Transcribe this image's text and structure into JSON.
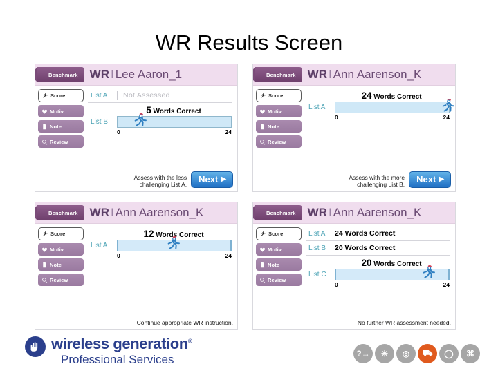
{
  "slide": {
    "title": "WR Results Screen"
  },
  "panels": [
    {
      "id": "panel-lee-aaron",
      "tab_label": "Benchmark",
      "title_prefix": "WR",
      "title_sep": "I",
      "student": "Lee Aaron_1",
      "sidebar": [
        {
          "label": "Score",
          "icon": "runner-icon",
          "active": true
        },
        {
          "label": "Motiv.",
          "icon": "heart-icon",
          "active": false
        },
        {
          "label": "Note",
          "icon": "note-icon",
          "active": false
        },
        {
          "label": "Review",
          "icon": "magnifier-icon",
          "active": false
        }
      ],
      "rows": [
        {
          "list": "List A",
          "status": "Not Assessed",
          "type": "not-assessed"
        }
      ],
      "bar": {
        "list": "List B",
        "score": 5,
        "caption_value": "5",
        "caption_text": "Words Correct",
        "min": "0",
        "max": "24",
        "max_value": 24,
        "style": "filled"
      },
      "footer_note": "Assess with the less\nchallenging List A.",
      "next_label": "Next",
      "next_arrow": "▶",
      "has_next": true
    },
    {
      "id": "panel-ann-aarenson-24",
      "tab_label": "Benchmark",
      "title_prefix": "WR",
      "title_sep": "I",
      "student": "Ann Aarenson_K",
      "sidebar": [
        {
          "label": "Score",
          "icon": "runner-icon",
          "active": true
        },
        {
          "label": "Motiv.",
          "icon": "heart-icon",
          "active": false
        },
        {
          "label": "Note",
          "icon": "note-icon",
          "active": false
        },
        {
          "label": "Review",
          "icon": "magnifier-icon",
          "active": false
        }
      ],
      "rows": [],
      "bar": {
        "list": "List A",
        "score": 24,
        "caption_value": "24",
        "caption_text": "Words Correct",
        "min": "0",
        "max": "24",
        "max_value": 24,
        "style": "filled"
      },
      "footer_note": "Assess with the more\nchallenging List B.",
      "next_label": "Next",
      "next_arrow": "▶",
      "has_next": true
    },
    {
      "id": "panel-ann-aarenson-12",
      "tab_label": "Benchmark",
      "title_prefix": "WR",
      "title_sep": "I",
      "student": "Ann Aarenson_K",
      "sidebar": [
        {
          "label": "Score",
          "icon": "runner-icon",
          "active": true
        },
        {
          "label": "Motiv.",
          "icon": "heart-icon",
          "active": false
        },
        {
          "label": "Note",
          "icon": "note-icon",
          "active": false
        },
        {
          "label": "Review",
          "icon": "magnifier-icon",
          "active": false
        }
      ],
      "rows": [],
      "bar": {
        "list": "List A",
        "score": 12,
        "caption_value": "12",
        "caption_text": "Words Correct",
        "min": "0",
        "max": "24",
        "max_value": 24,
        "style": "open"
      },
      "footer_note": "Continue appropriate WR instruction.",
      "next_label": "",
      "next_arrow": "",
      "has_next": false
    },
    {
      "id": "panel-ann-aarenson-final",
      "tab_label": "Benchmark",
      "title_prefix": "WR",
      "title_sep": "I",
      "student": "Ann Aarenson_K",
      "sidebar": [
        {
          "label": "Score",
          "icon": "runner-icon",
          "active": true
        },
        {
          "label": "Motiv.",
          "icon": "heart-icon",
          "active": false
        },
        {
          "label": "Note",
          "icon": "note-icon",
          "active": false
        },
        {
          "label": "Review",
          "icon": "magnifier-icon",
          "active": false
        }
      ],
      "rows": [
        {
          "list": "List A",
          "status": "24 Words Correct",
          "type": "score"
        },
        {
          "list": "List B",
          "status": "20 Words Correct",
          "type": "score"
        }
      ],
      "bar": {
        "list": "List C",
        "score": 20,
        "caption_value": "20",
        "caption_text": "Words Correct",
        "min": "0",
        "max": "24",
        "max_value": 24,
        "style": "open"
      },
      "footer_note": "No further WR assessment needed.",
      "next_label": "",
      "next_arrow": "",
      "has_next": false
    }
  ],
  "logo": {
    "mark": "hand-icon",
    "line1": "wireless generation",
    "registered": "®",
    "line2": "Professional Services"
  },
  "footer_icons": [
    {
      "name": "question-arrow-icon",
      "glyph": "?→",
      "accent": false
    },
    {
      "name": "snowflake-icon",
      "glyph": "✳",
      "accent": false
    },
    {
      "name": "speech-target-icon",
      "glyph": "◎",
      "accent": false
    },
    {
      "name": "cart-icon",
      "glyph": "⛟",
      "accent": true
    },
    {
      "name": "lightbulb-icon",
      "glyph": "◯",
      "accent": false
    },
    {
      "name": "grid-globe-icon",
      "glyph": "⌘",
      "accent": false
    }
  ],
  "colors": {
    "accent_purple": "#7b4c79",
    "header_lavender": "#f0ddee",
    "list_teal": "#4ba3b5",
    "bar_blue": "#cfe8f7",
    "next_blue": "#1f6fc4",
    "logo_navy": "#2b3f8c",
    "icon_accent": "#e05a1e"
  }
}
